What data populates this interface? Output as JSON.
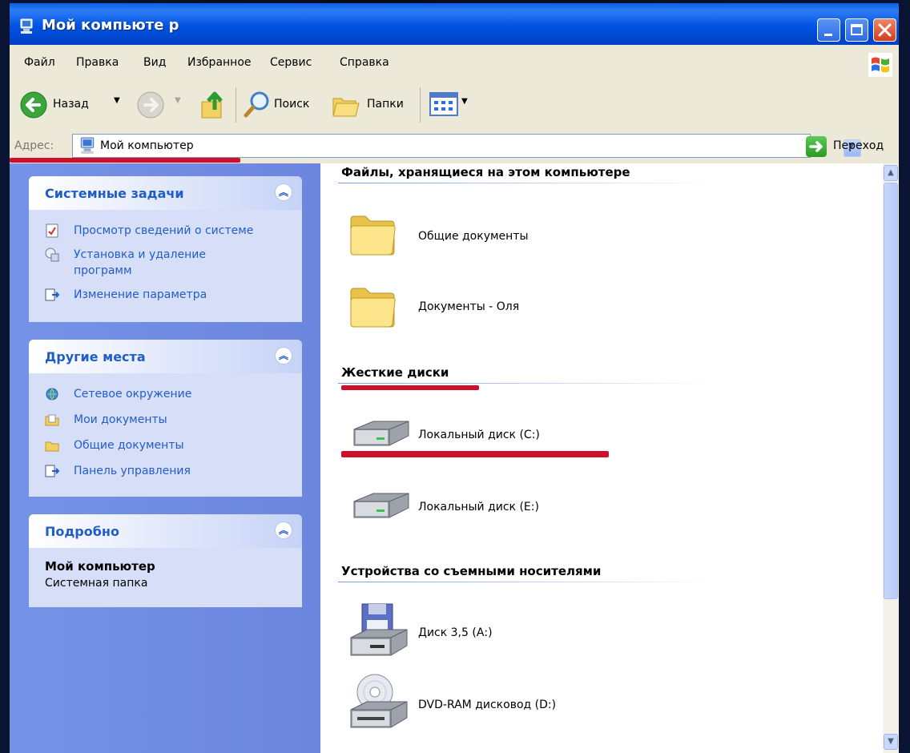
{
  "window": {
    "title": "Мой компьюте р"
  },
  "menu": {
    "items": [
      "Файл",
      "Правка",
      "Вид",
      "Избранное",
      "Сервис",
      "Справка"
    ]
  },
  "toolbar": {
    "back_label": "Назад",
    "search_label": "Поиск",
    "folders_label": "Папки"
  },
  "address": {
    "label": "Адрес:",
    "value": "Мой компьютер",
    "go_label": "Переход"
  },
  "tasks": {
    "system": {
      "title": "Системные задачи",
      "items": [
        {
          "label": "Просмотр сведений о системе",
          "icon": "system-info-icon"
        },
        {
          "label": "Установка и удаление",
          "label2": "программ",
          "icon": "add-remove-programs-icon"
        },
        {
          "label": "Изменение параметра",
          "icon": "change-setting-icon"
        }
      ]
    },
    "places": {
      "title": "Другие места",
      "items": [
        {
          "label": "Сетевое окружение",
          "icon": "network-icon"
        },
        {
          "label": "Мои документы",
          "icon": "my-documents-icon"
        },
        {
          "label": "Общие документы",
          "icon": "shared-documents-icon"
        },
        {
          "label": "Панель управления",
          "icon": "control-panel-icon"
        }
      ]
    },
    "details": {
      "title": "Подробно",
      "name": "Мой компьютер",
      "type": "Системная папка"
    }
  },
  "content": {
    "groups": [
      {
        "title": "Файлы, хранящиеся на этом компьютере",
        "items": [
          {
            "label": "Общие документы",
            "icon": "folder-icon"
          },
          {
            "label": "Документы - Оля",
            "icon": "folder-icon"
          }
        ]
      },
      {
        "title": "Жесткие диски",
        "items": [
          {
            "label": "Локальный диск (C:)",
            "icon": "hard-disk-icon"
          },
          {
            "label": "Локальный диск (E:)",
            "icon": "hard-disk-icon"
          }
        ]
      },
      {
        "title": "Устройства со съемными носителями",
        "items": [
          {
            "label": "Диск 3,5 (А:)",
            "icon": "floppy-drive-icon"
          },
          {
            "label": "DVD-RAM дисковод (D:)",
            "icon": "dvd-drive-icon"
          }
        ]
      }
    ]
  },
  "colors": {
    "title_bar": "#0053e1",
    "task_pane": "#6c86dd",
    "task_link": "#215dc6",
    "highlight_underline": "#d0102a"
  }
}
